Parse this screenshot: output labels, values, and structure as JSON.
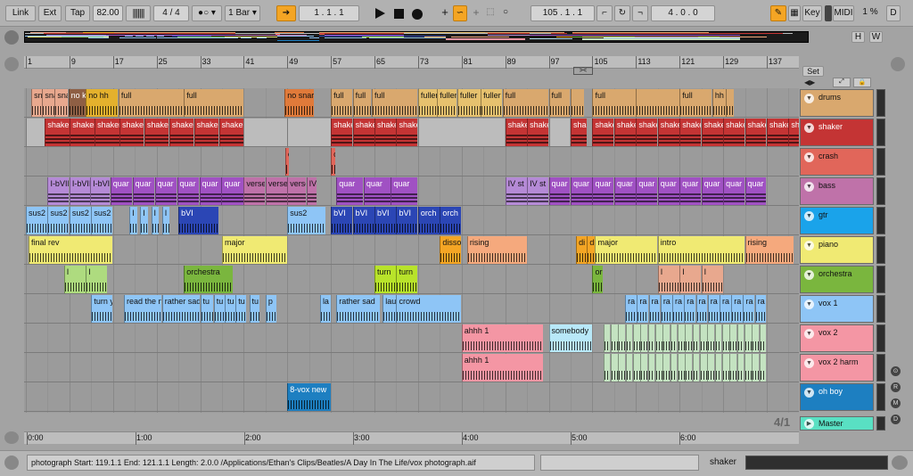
{
  "toolbar": {
    "link": "Link",
    "ext": "Ext",
    "tap": "Tap",
    "tempo": "82.00",
    "signature": "4 / 4",
    "quantize": "1 Bar",
    "position": "1 .  1 .  1",
    "loop_start": "105 .  1 .  1",
    "loop_length": "4 .  0 .  0",
    "key": "Key",
    "midi": "MIDI",
    "cpu": "1 %",
    "d": "D"
  },
  "overview": {
    "h": "H",
    "w": "W"
  },
  "set_label": "Set",
  "ruler": {
    "bars": [
      "1",
      "9",
      "17",
      "25",
      "33",
      "41",
      "49",
      "57",
      "65",
      "73",
      "81",
      "89",
      "97",
      "105",
      "113",
      "121",
      "129",
      "137"
    ]
  },
  "time": {
    "labels": [
      "0:00",
      "1:00",
      "2:00",
      "3:00",
      "4:00",
      "5:00",
      "6:00"
    ]
  },
  "grid_ratio": "4/1",
  "tracks": [
    {
      "name": "drums",
      "color": "#d9a86e"
    },
    {
      "name": "shaker",
      "color": "#c43434"
    },
    {
      "name": "crash",
      "color": "#e1665a"
    },
    {
      "name": "bass",
      "color": "#bf72a9"
    },
    {
      "name": "gtr",
      "color": "#1aa3ea"
    },
    {
      "name": "piano",
      "color": "#f0ea73"
    },
    {
      "name": "orchestra",
      "color": "#7ab63e"
    },
    {
      "name": "vox 1",
      "color": "#8ec5f6"
    },
    {
      "name": "vox 2",
      "color": "#f496a4"
    },
    {
      "name": "vox 2 harm",
      "color": "#f496a4"
    },
    {
      "name": "oh boy",
      "color": "#1d7fc1"
    },
    {
      "name": "Master",
      "color": "#59e0c3"
    }
  ],
  "clips": [
    {
      "track": 0,
      "start": 2,
      "end": 4,
      "label": "sn",
      "color": "#e8a88e"
    },
    {
      "track": 0,
      "start": 4,
      "end": 6.3,
      "label": "snare",
      "color": "#e8a88e"
    },
    {
      "track": 0,
      "start": 6.3,
      "end": 8.8,
      "label": "snare",
      "color": "#e8a88e"
    },
    {
      "track": 0,
      "start": 8.8,
      "end": 12,
      "label": "no kick",
      "color": "#8e5f44"
    },
    {
      "track": 0,
      "start": 12,
      "end": 18,
      "label": "no hh",
      "color": "#e4b12d"
    },
    {
      "track": 0,
      "start": 18,
      "end": 30,
      "label": "full",
      "color": "#d9a86e"
    },
    {
      "track": 0,
      "start": 30,
      "end": 41,
      "label": "full",
      "color": "#d9a86e"
    },
    {
      "track": 0,
      "start": 48.5,
      "end": 54,
      "label": "no snare",
      "color": "#e07a3a"
    },
    {
      "track": 0,
      "start": 57,
      "end": 61,
      "label": "full",
      "color": "#d9a86e"
    },
    {
      "track": 0,
      "start": 61,
      "end": 64.5,
      "label": "full",
      "color": "#d9a86e"
    },
    {
      "track": 0,
      "start": 64.5,
      "end": 73,
      "label": "full",
      "color": "#d9a86e"
    },
    {
      "track": 0,
      "start": 73,
      "end": 76.5,
      "label": "fuller",
      "color": "#e6c16e"
    },
    {
      "track": 0,
      "start": 76.5,
      "end": 80.2,
      "label": "fuller",
      "color": "#e6c16e"
    },
    {
      "track": 0,
      "start": 80.2,
      "end": 84.5,
      "label": "fuller",
      "color": "#e6c16e"
    },
    {
      "track": 0,
      "start": 84.5,
      "end": 88.5,
      "label": "fuller",
      "color": "#e6c16e"
    },
    {
      "track": 0,
      "start": 88.5,
      "end": 97,
      "label": "full",
      "color": "#d9a86e"
    },
    {
      "track": 0,
      "start": 97,
      "end": 101,
      "label": "full",
      "color": "#d9a86e"
    },
    {
      "track": 0,
      "start": 101,
      "end": 103.5,
      "label": "",
      "color": "#d9a86e"
    },
    {
      "track": 0,
      "start": 105,
      "end": 113,
      "label": "full",
      "color": "#d9a86e"
    },
    {
      "track": 0,
      "start": 113,
      "end": 121,
      "label": "",
      "color": "#d9a86e"
    },
    {
      "track": 0,
      "start": 121,
      "end": 127,
      "label": "full",
      "color": "#d9a86e"
    },
    {
      "track": 0,
      "start": 127,
      "end": 129.5,
      "label": "hh on",
      "color": "#d9a86e"
    },
    {
      "track": 0,
      "start": 129.5,
      "end": 131,
      "label": "",
      "color": "#d9a86e"
    },
    {
      "track": 1,
      "start": 1,
      "end": 4.5,
      "label": "",
      "color": "#bcbcbc"
    },
    {
      "track": 1,
      "start": 4.5,
      "end": 41,
      "label": "shaker",
      "color": "#c43434",
      "repeat": 8
    },
    {
      "track": 1,
      "start": 41,
      "end": 49,
      "label": "",
      "color": "#bcbcbc"
    },
    {
      "track": 1,
      "start": 49,
      "end": 57,
      "label": "",
      "color": "#bcbcbc"
    },
    {
      "track": 1,
      "start": 57,
      "end": 73,
      "label": "shaker",
      "color": "#c43434",
      "repeat": 4
    },
    {
      "track": 1,
      "start": 73,
      "end": 89,
      "label": "",
      "color": "#bcbcbc"
    },
    {
      "track": 1,
      "start": 89,
      "end": 97,
      "label": "shaker",
      "color": "#c43434",
      "repeat": 2
    },
    {
      "track": 1,
      "start": 97,
      "end": 101,
      "label": "",
      "color": "#bcbcbc"
    },
    {
      "track": 1,
      "start": 101,
      "end": 104,
      "label": "shaker",
      "color": "#c43434"
    },
    {
      "track": 1,
      "start": 105,
      "end": 145,
      "label": "shaker",
      "color": "#c43434",
      "repeat": 10
    },
    {
      "track": 1,
      "start": 145,
      "end": 147,
      "label": "",
      "color": "#bcbcbc"
    },
    {
      "track": 2,
      "start": 48.6,
      "end": 49.4,
      "label": "c",
      "color": "#e1665a"
    },
    {
      "track": 2,
      "start": 57,
      "end": 57.9,
      "label": "c",
      "color": "#e1665a"
    },
    {
      "track": 3,
      "start": 5,
      "end": 9,
      "label": "I-bVII",
      "color": "#b58ad6"
    },
    {
      "track": 3,
      "start": 9,
      "end": 12.8,
      "label": "I-bVII",
      "color": "#b58ad6"
    },
    {
      "track": 3,
      "start": 12.8,
      "end": 16.5,
      "label": "I-bVII",
      "color": "#b58ad6"
    },
    {
      "track": 3,
      "start": 16.5,
      "end": 41,
      "label": "quar",
      "color": "#a051c3",
      "repeat": 6
    },
    {
      "track": 3,
      "start": 41,
      "end": 45,
      "label": "verse",
      "color": "#bf72a9"
    },
    {
      "track": 3,
      "start": 45,
      "end": 49,
      "label": "verse",
      "color": "#bf72a9"
    },
    {
      "track": 3,
      "start": 49,
      "end": 52.5,
      "label": "verse",
      "color": "#bf72a9"
    },
    {
      "track": 3,
      "start": 52.5,
      "end": 54.5,
      "label": "IV s",
      "color": "#bf72a9"
    },
    {
      "track": 3,
      "start": 58,
      "end": 73,
      "label": "quar",
      "color": "#a051c3",
      "repeat": 3
    },
    {
      "track": 3,
      "start": 89,
      "end": 93,
      "label": "IV st",
      "color": "#b58ad6"
    },
    {
      "track": 3,
      "start": 93,
      "end": 97,
      "label": "IV st",
      "color": "#b58ad6"
    },
    {
      "track": 3,
      "start": 97,
      "end": 137,
      "label": "quar",
      "color": "#a051c3",
      "repeat": 10
    },
    {
      "track": 4,
      "start": 1,
      "end": 5,
      "label": "sus2",
      "color": "#8ec5f6"
    },
    {
      "track": 4,
      "start": 5,
      "end": 9,
      "label": "sus2",
      "color": "#8ec5f6"
    },
    {
      "track": 4,
      "start": 9,
      "end": 13,
      "label": "sus2",
      "color": "#8ec5f6"
    },
    {
      "track": 4,
      "start": 13,
      "end": 17,
      "label": "sus2",
      "color": "#8ec5f6"
    },
    {
      "track": 4,
      "start": 20,
      "end": 21.5,
      "label": "I",
      "color": "#8ec5f6"
    },
    {
      "track": 4,
      "start": 22,
      "end": 23.5,
      "label": "I",
      "color": "#8ec5f6"
    },
    {
      "track": 4,
      "start": 24,
      "end": 25.5,
      "label": "I",
      "color": "#8ec5f6"
    },
    {
      "track": 4,
      "start": 26,
      "end": 27.5,
      "label": "I",
      "color": "#8ec5f6"
    },
    {
      "track": 4,
      "start": 29,
      "end": 36.5,
      "label": "bVI",
      "color": "#2b46b5"
    },
    {
      "track": 4,
      "start": 49,
      "end": 56,
      "label": "sus2",
      "color": "#8ec5f6"
    },
    {
      "track": 4,
      "start": 57,
      "end": 61,
      "label": "bVI",
      "color": "#2b46b5"
    },
    {
      "track": 4,
      "start": 61,
      "end": 65,
      "label": "bVI",
      "color": "#2b46b5"
    },
    {
      "track": 4,
      "start": 65,
      "end": 69,
      "label": "bVI",
      "color": "#2b46b5"
    },
    {
      "track": 4,
      "start": 69,
      "end": 73,
      "label": "bVI",
      "color": "#2b46b5"
    },
    {
      "track": 4,
      "start": 73,
      "end": 77,
      "label": "orch",
      "color": "#2b46b5"
    },
    {
      "track": 4,
      "start": 77,
      "end": 81,
      "label": "orch",
      "color": "#2b46b5"
    },
    {
      "track": 5,
      "start": 1.5,
      "end": 17,
      "label": "final rev",
      "color": "#f0ea73"
    },
    {
      "track": 5,
      "start": 37,
      "end": 49,
      "label": "major",
      "color": "#f0ea73"
    },
    {
      "track": 5,
      "start": 77,
      "end": 81,
      "label": "disso",
      "color": "#f4a524"
    },
    {
      "track": 5,
      "start": 82,
      "end": 93,
      "label": "rising",
      "color": "#f5a97d"
    },
    {
      "track": 5,
      "start": 102,
      "end": 104,
      "label": "di",
      "color": "#f4a524"
    },
    {
      "track": 5,
      "start": 104,
      "end": 105.5,
      "label": "di",
      "color": "#f4a524"
    },
    {
      "track": 5,
      "start": 105.5,
      "end": 117,
      "label": "major",
      "color": "#f0ea73"
    },
    {
      "track": 5,
      "start": 117,
      "end": 133,
      "label": "intro",
      "color": "#f0ea73"
    },
    {
      "track": 5,
      "start": 133,
      "end": 142,
      "label": "rising",
      "color": "#f5a97d"
    },
    {
      "track": 6,
      "start": 8,
      "end": 12,
      "label": "I",
      "color": "#aedb7f"
    },
    {
      "track": 6,
      "start": 12,
      "end": 16,
      "label": "I",
      "color": "#aedb7f"
    },
    {
      "track": 6,
      "start": 30,
      "end": 39,
      "label": "orchestra",
      "color": "#7ab63e"
    },
    {
      "track": 6,
      "start": 65,
      "end": 69,
      "label": "turn",
      "color": "#b8e32a"
    },
    {
      "track": 6,
      "start": 69,
      "end": 73,
      "label": "turn",
      "color": "#b8e32a"
    },
    {
      "track": 6,
      "start": 105,
      "end": 107,
      "label": "or",
      "color": "#7ab63e"
    },
    {
      "track": 6,
      "start": 117,
      "end": 121,
      "label": "I",
      "color": "#e8a88e"
    },
    {
      "track": 6,
      "start": 121,
      "end": 125,
      "label": "I",
      "color": "#e8a88e"
    },
    {
      "track": 6,
      "start": 125,
      "end": 129,
      "label": "I",
      "color": "#e8a88e"
    },
    {
      "track": 7,
      "start": 13,
      "end": 17,
      "label": "turn y",
      "color": "#8ec5f6"
    },
    {
      "track": 7,
      "start": 19,
      "end": 26,
      "label": "read the n",
      "color": "#8ec5f6"
    },
    {
      "track": 7,
      "start": 26,
      "end": 33,
      "label": "rather sad",
      "color": "#8ec5f6"
    },
    {
      "track": 7,
      "start": 33,
      "end": 35.5,
      "label": "tu",
      "color": "#8ec5f6"
    },
    {
      "track": 7,
      "start": 35.5,
      "end": 37.5,
      "label": "tu",
      "color": "#8ec5f6"
    },
    {
      "track": 7,
      "start": 37.5,
      "end": 39.5,
      "label": "tu",
      "color": "#8ec5f6"
    },
    {
      "track": 7,
      "start": 39.5,
      "end": 41.5,
      "label": "tu",
      "color": "#8ec5f6"
    },
    {
      "track": 7,
      "start": 42,
      "end": 44,
      "label": "tu",
      "color": "#8ec5f6"
    },
    {
      "track": 7,
      "start": 45,
      "end": 47,
      "label": "p",
      "color": "#8ec5f6"
    },
    {
      "track": 7,
      "start": 55,
      "end": 57,
      "label": "la",
      "color": "#8ec5f6"
    },
    {
      "track": 7,
      "start": 58,
      "end": 66,
      "label": "rather sad",
      "color": "#8ec5f6"
    },
    {
      "track": 7,
      "start": 66.5,
      "end": 69,
      "label": "laug",
      "color": "#8ec5f6"
    },
    {
      "track": 7,
      "start": 69,
      "end": 81,
      "label": "crowd",
      "color": "#8ec5f6"
    },
    {
      "track": 7,
      "start": 111,
      "end": 137,
      "label": "ra",
      "color": "#8ec5f6",
      "repeat": 12
    },
    {
      "track": 8,
      "start": 81,
      "end": 96,
      "label": "ahhh 1",
      "color": "#f496a4"
    },
    {
      "track": 8,
      "start": 97,
      "end": 105,
      "label": "somebody",
      "color": "#b8e8f8"
    },
    {
      "track": 8,
      "start": 107,
      "end": 137,
      "label": "",
      "color": "#c4e3c1",
      "repeat": 22
    },
    {
      "track": 9,
      "start": 81,
      "end": 96,
      "label": "ahhh 1",
      "color": "#f496a4"
    },
    {
      "track": 9,
      "start": 107,
      "end": 137,
      "label": "",
      "color": "#c4e3c1",
      "repeat": 22
    },
    {
      "track": 10,
      "start": 49,
      "end": 57,
      "label": "8-vox new",
      "color": "#1d7fc1"
    }
  ],
  "status": {
    "text": "photograph  Start: 119.1.1  End: 121.1.1  Length: 2.0.0  /Applications/Ethan's Clips/Beatles/A Day In The Life/vox photograph.aif",
    "track": "shaker"
  }
}
